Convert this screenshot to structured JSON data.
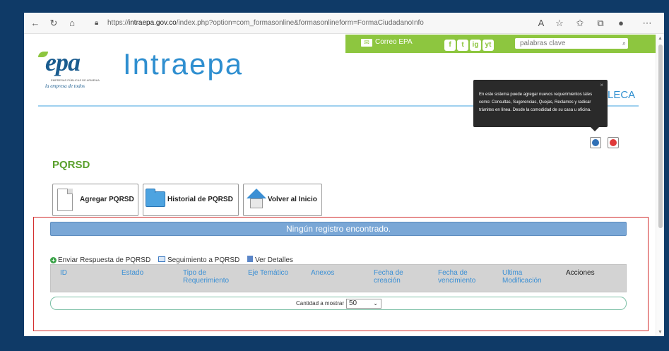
{
  "browser": {
    "url_prefix": "https://",
    "url_host": "intraepa.gov.co",
    "url_path": "/index.php?option=com_formasonline&formasonlineform=FormaCiudadanoInfo",
    "icons": [
      "back-icon",
      "refresh-icon",
      "home-icon",
      "lock-icon",
      "read-aloud-icon",
      "tracking-icon",
      "favorites-icon",
      "collections-icon",
      "profile-icon",
      "more-icon"
    ]
  },
  "topbar": {
    "correo_label": "Correo EPA",
    "social": [
      "f",
      "t",
      "ig",
      "yt"
    ],
    "search_placeholder": "palabras clave"
  },
  "logo": {
    "script": "epa",
    "subtitle": "EMPRESAS PÚBLICAS DE ARMENIA",
    "tagline": "la empresa de todos",
    "title": "Intraepa"
  },
  "tooltip": {
    "text": "En este sistema puede agregar nuevos requerimientos tales como: Consultas, Sugerencias, Quejas, Reclamos y radicar trámites en línea. Desde la comodidad de su casa u oficina.",
    "close": "×"
  },
  "header_right": "LECA",
  "page": {
    "title": "PQRSD",
    "buttons": {
      "add": "Agregar PQRSD",
      "history": "Historial de PQRSD",
      "home": "Volver al Inicio"
    },
    "no_records": "Ningún registro encontrado.",
    "actions": {
      "send": "Enviar Respuesta de PQRSD",
      "follow": "Seguimiento a PQRSD",
      "details": "Ver Detalles"
    },
    "columns": {
      "id": "ID",
      "estado": "Estado",
      "tipo_1": "Tipo de",
      "tipo_2": "Requerimiento",
      "eje": "Eje Temático",
      "anexos": "Anexos",
      "fc_1": "Fecha de",
      "fc_2": "creación",
      "fv_1": "Fecha de",
      "fv_2": "vencimiento",
      "um_1": "Ultima",
      "um_2": "Modificación",
      "acciones": "Acciones"
    },
    "footer": {
      "label": "Cantidad a mostrar",
      "value": "50"
    }
  },
  "colors": {
    "brand_green": "#8dc63f",
    "brand_blue": "#2f8fd0",
    "title_green": "#5aa02c",
    "panel_border": "#d32f2f"
  }
}
